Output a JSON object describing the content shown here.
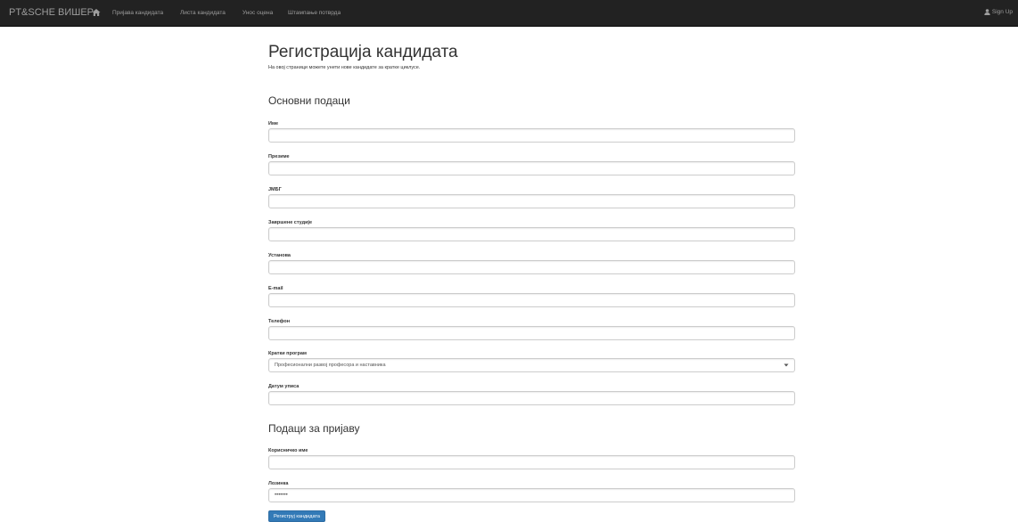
{
  "navbar": {
    "brand": "PT&SCHE ВИШЕР",
    "home_icon": "home-icon",
    "links": [
      "Пријава кандидата",
      "Листа кандидата",
      "Унос оцена",
      "Штампање потврда"
    ],
    "signup_icon": "user-icon",
    "signup_label": "Sign Up"
  },
  "page": {
    "title": "Регистрација кандидата",
    "subtitle": "На овој страници можете унети нове кандидате за кратке циклусе."
  },
  "basic": {
    "title": "Основни подаци",
    "fields": {
      "first_name": {
        "label": "Име",
        "value": ""
      },
      "last_name": {
        "label": "Презиме",
        "value": ""
      },
      "jmbg": {
        "label": "ЈМБГ",
        "value": ""
      },
      "studies": {
        "label": "Завршене студије",
        "value": ""
      },
      "institution": {
        "label": "Установа",
        "value": ""
      },
      "email": {
        "label": "E-mail",
        "value": ""
      },
      "phone": {
        "label": "Телефон",
        "value": ""
      },
      "program": {
        "label": "Кратки програм",
        "value": "Професионални развој професора и наставника"
      },
      "enroll_date": {
        "label": "Датум уписа",
        "value": ""
      }
    }
  },
  "login": {
    "title": "Подаци за пријаву",
    "fields": {
      "username": {
        "label": "Корисничко име",
        "value": ""
      },
      "password": {
        "label": "Лозинка",
        "value": "•••••••"
      }
    }
  },
  "submit_label": "Региструј кандидата",
  "colors": {
    "navbar_bg": "#222222",
    "nav_text": "#9d9d9d",
    "primary": "#337ab7"
  }
}
